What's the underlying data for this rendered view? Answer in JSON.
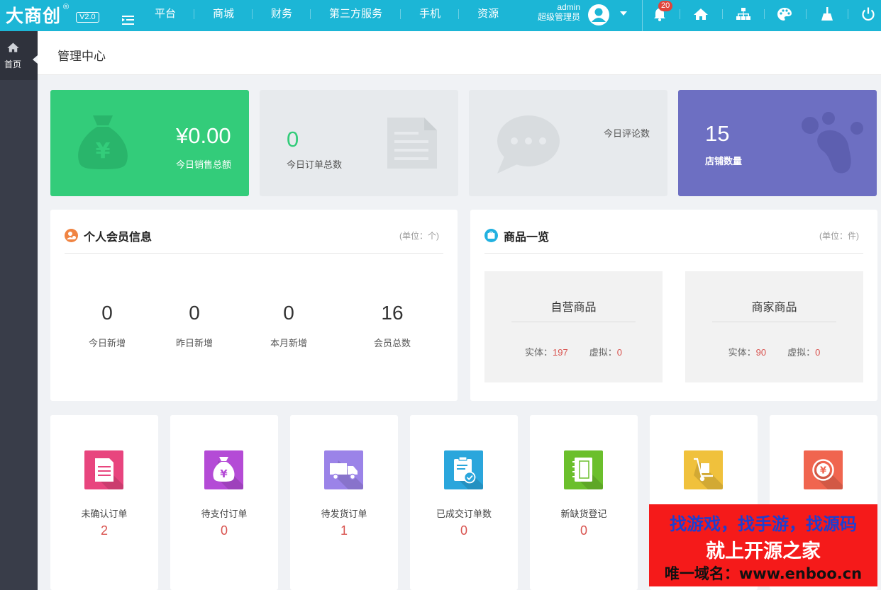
{
  "header": {
    "logo": "大商创",
    "logo_mark": "®",
    "version": "V2.0",
    "nav": [
      "平台",
      "商城",
      "财务",
      "第三方服务",
      "手机",
      "资源"
    ],
    "user_name": "admin",
    "user_role": "超级管理员",
    "notification_count": "20",
    "icons": [
      "menu-toggle-icon",
      "bell-icon",
      "home-icon",
      "sitemap-icon",
      "palette-icon",
      "broom-icon",
      "power-icon"
    ]
  },
  "sidebar": {
    "home_label": "首页"
  },
  "page": {
    "title": "管理中心"
  },
  "stats": [
    {
      "value": "¥0.00",
      "label": "今日销售总额",
      "bg": "#33cc7a",
      "icon": "money-bag-icon"
    },
    {
      "value": "0",
      "label": "今日订单总数",
      "bg": "#e7eaed",
      "icon": "document-icon"
    },
    {
      "value": "",
      "label": "今日评论数",
      "bg": "#e7eaed",
      "icon": "chat-bubble-icon"
    },
    {
      "value": "15",
      "label": "店铺数量",
      "bg": "#6d6fc2",
      "icon": "paw-icon"
    }
  ],
  "members": {
    "title": "个人会员信息",
    "unit": "(单位：个)",
    "items": [
      {
        "value": "0",
        "label": "今日新增"
      },
      {
        "value": "0",
        "label": "昨日新增"
      },
      {
        "value": "0",
        "label": "本月新增"
      },
      {
        "value": "16",
        "label": "会员总数"
      }
    ]
  },
  "goods": {
    "title": "商品一览",
    "unit": "(单位：件)",
    "boxes": [
      {
        "title": "自营商品",
        "physical_label": "实体：",
        "physical": "197",
        "virtual_label": "虚拟：",
        "virtual": "0"
      },
      {
        "title": "商家商品",
        "physical_label": "实体：",
        "physical": "90",
        "virtual_label": "虚拟：",
        "virtual": "0"
      }
    ]
  },
  "orders": [
    {
      "label": "未确认订单",
      "value": "2",
      "color": "#e8457e"
    },
    {
      "label": "待支付订单",
      "value": "0",
      "color": "#b44bd6"
    },
    {
      "label": "待发货订单",
      "value": "1",
      "color": "#9b83e8"
    },
    {
      "label": "已成交订单数",
      "value": "0",
      "color": "#2aa6dc"
    },
    {
      "label": "新缺货登记",
      "value": "0",
      "color": "#6bbf2c"
    },
    {
      "label": "",
      "value": "",
      "color": "#f0c13c"
    },
    {
      "label": "",
      "value": "",
      "color": "#f0654f"
    }
  ],
  "watermark": {
    "line1": "找游戏，找手游，找源码",
    "line2": "就上开源之家",
    "line3": "唯一域名：www.enboo.cn"
  }
}
